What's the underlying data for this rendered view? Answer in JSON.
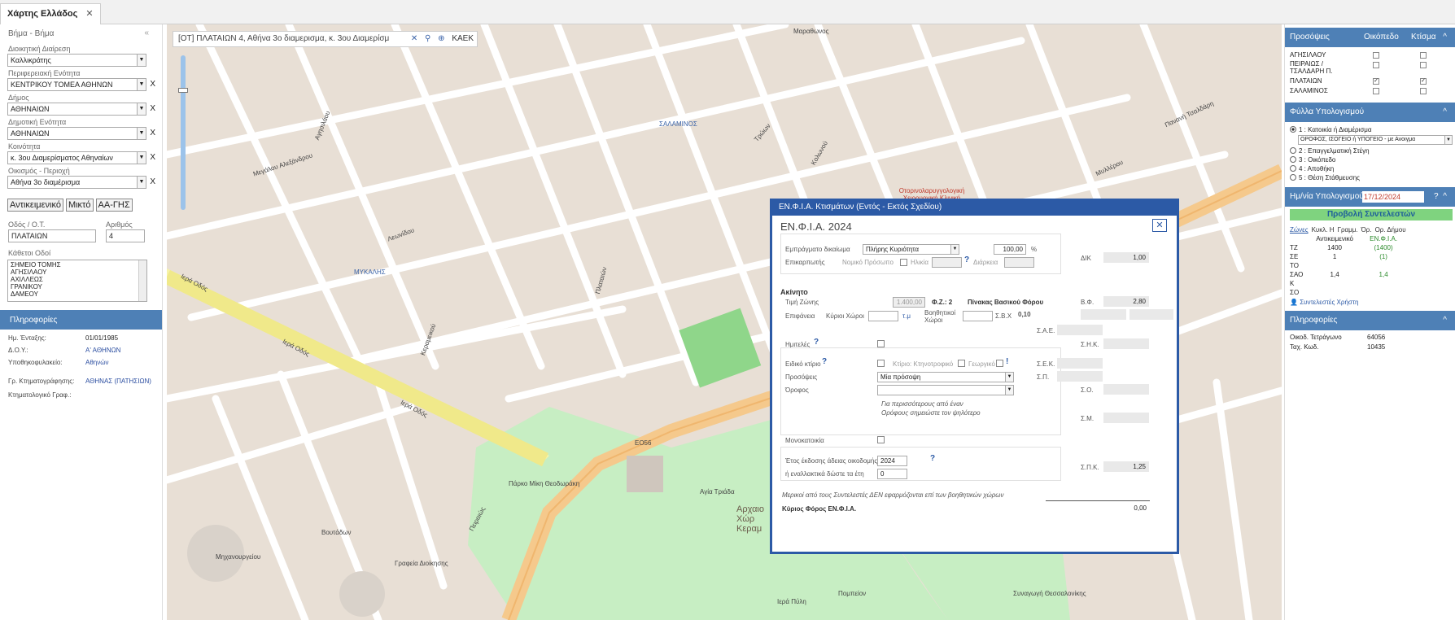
{
  "tab": {
    "title": "Χάρτης Ελλάδος",
    "close": "✕"
  },
  "left": {
    "step": "Βήμα - Βήμα",
    "fields": [
      {
        "label": "Διοικητική Διαίρεση",
        "value": "Καλλικράτης",
        "clear": ""
      },
      {
        "label": "Περιφερειακή Ενότητα",
        "value": "ΚΕΝΤΡΙΚΟΥ ΤΟΜΕΑ ΑΘΗΝΩΝ",
        "clear": "X"
      },
      {
        "label": "Δήμος",
        "value": "ΑΘΗΝΑΙΩΝ",
        "clear": "X"
      },
      {
        "label": "Δημοτική Ενότητα",
        "value": "ΑΘΗΝΑΙΩΝ",
        "clear": "X"
      },
      {
        "label": "Κοινότητα",
        "value": "κ. 3ου Διαμερίσματος Αθηναίων",
        "clear": "X"
      },
      {
        "label": "Οικισμός - Περιοχή",
        "value": "Αθήνα 3ο διαμέρισμα",
        "clear": "X"
      }
    ],
    "buttons": [
      "Αντικειμενικό",
      "Μικτό",
      "ΑΑ-ΓΗΣ"
    ],
    "street_label": "Οδός / Ο.Τ.",
    "number_label": "Αριθμός",
    "street_value": "ΠΛΑΤΑΙΩΝ",
    "number_value": "4",
    "cross_label": "Κάθετοι Οδοί",
    "cross_streets": [
      "ΣΗΜΕΙΟ ΤΟΜΗΣ",
      "ΑΓΗΣΙΛΑΟΥ",
      "ΑΧΙΛΛΕΩΣ",
      "ΓΡΑΝΙΚΟΥ",
      "ΔΑΜΕΟΥ"
    ],
    "info_title": "Πληροφορίες",
    "info": [
      {
        "k": "Ημ. Ένταξης:",
        "v": "01/01/1985"
      },
      {
        "k": "Δ.Ο.Υ.:",
        "v": "Α' ΑΘΗΝΩΝ"
      },
      {
        "k": "Υποθηκοφυλακείο:",
        "v": "Αθηνών"
      },
      {
        "k": "Γρ. Κτηματογράφησης:",
        "v": "ΑΘΗΝΑΣ (ΠΑΤΗΣΙΩΝ)"
      },
      {
        "k": "Κτηματολογικό Γραφ.:",
        "v": ""
      }
    ]
  },
  "map": {
    "search_text": "[ΟΤ] ΠΛΑΤΑΙΩΝ 4, Αθήνα 3ο διαμερισμα, κ. 3ου Διαμερίσμ",
    "search_icons": [
      "✕",
      "⚲",
      "⊕"
    ],
    "kaek": "ΚΑΕΚ",
    "labels": [
      {
        "t": "Ιερά Οδός"
      },
      {
        "t": "Ιερά Οδός"
      },
      {
        "t": "Ιερά Οδός"
      },
      {
        "t": "Πειραιώς"
      },
      {
        "t": "Πλαταιών"
      },
      {
        "t": "Κεραμεικού"
      },
      {
        "t": "Μεγάλου Αλεξάνδρου"
      },
      {
        "t": "Λεωνίδου"
      },
      {
        "t": "Αγησιλάου"
      },
      {
        "t": "Κολωνού"
      },
      {
        "t": "Μυλλέρου"
      },
      {
        "t": "Πανανή Τσαλδάρη"
      },
      {
        "t": "Μαραθωνος"
      },
      {
        "t": "Τρώων"
      },
      {
        "t": "Μηχανουργείου"
      },
      {
        "t": "Βουτάδων"
      },
      {
        "t": "Πάρκο Μίκη Θεοδωράκη"
      },
      {
        "t": "Αγία Τριάδα"
      },
      {
        "t": "Γραφεία Διοίκησης"
      },
      {
        "t": "ΕΟ56"
      },
      {
        "t": "ΜΥΚΑΛΗΣ"
      },
      {
        "t": "ΣΑΛΑΜΙΝΟΣ"
      },
      {
        "t": "Οτορινολαρυγγολογική Χειρουργική Κλινική"
      },
      {
        "t": "Αρχαιο Χώρ Κεραμ"
      },
      {
        "t": "Πομπείον"
      },
      {
        "t": "Ιερά Πύλη"
      },
      {
        "t": "Συναγωγή Θεσσαλονίκης"
      }
    ]
  },
  "dialog": {
    "title": "ΕΝ.Φ.Ι.Α. Κτισμάτων (Εντός - Εκτός Σχεδίου)",
    "heading": "ΕΝ.Φ.Ι.Α. 2024",
    "close": "✕",
    "rights_label": "Εμπράγματο δικαίωμα",
    "rights_value": "Πλήρης Κυριότητα",
    "percent_value": "100,00",
    "percent_unit": "%",
    "usufruct_label": "Επικαρπωτής",
    "legal_label": "Νομικό Πρόσωπο",
    "age_label": "Ηλικία",
    "duration_label": "Διάρκεια",
    "dik_label": "ΔΙΚ",
    "dik_value": "1,00",
    "property_label": "Ακίνητο",
    "zone_price_label": "Τιμή Ζώνης",
    "zone_price_value": "1.400,00",
    "fz_label": "Φ.Ζ.: 2",
    "table_label": "Πίνακας Βασικού Φόρου",
    "bf_label": "Β.Φ.",
    "bf_value": "2,80",
    "area_label": "Επιφάνεια",
    "main_area_label": "Κύριοι Χώροι",
    "area_unit": "τ.μ",
    "aux_label": "Βοηθητικοί Χώροι",
    "sbx_label": "Σ.Β.Χ",
    "sbx_value": "0,10",
    "sae_label": "Σ.Α.Ε.",
    "half_label": "Ημιτελές",
    "snk_label": "Σ.Η.Κ.",
    "special_label": "Ειδικό κτίριο",
    "special_opts": "Κτίριο: Κτηνοτροφικό",
    "special_opts2": "Γεωργικό",
    "sek_label": "Σ.Ε.Κ.",
    "sp_label": "Σ.Π.",
    "facades_label": "Προσόψεις",
    "facades_value": "Μία πρόσοψη",
    "floor_label": "Όροφος",
    "floor_value": "",
    "so_label": "Σ.Ο.",
    "note1": "Για περισσότερους από έναν",
    "note2": "Ορόφους σημειώστε τον ψηλότερο",
    "sm_label": "Σ.Μ.",
    "single_label": "Μονοκατοικία",
    "year_label": "Έτος έκδοσης άδειας οικοδομής",
    "year_value": "2024",
    "alt_label": "ή εναλλακτικά δώστε τα έτη",
    "alt_value": "0",
    "spk_label": "Σ.Π.Κ.",
    "spk_value": "1,25",
    "footnote": "Μερικοί από τους Συντελεστές ΔΕΝ εφαρμόζονται επί των βοηθητικών χώρων",
    "tax_label": "Κύριος Φόρος ΕΝ.Φ.Ι.Α.",
    "tax_value": "0,00",
    "q": "?"
  },
  "right": {
    "facades_title": "Προσόψεις",
    "col_plot": "Οικόπεδο",
    "col_building": "Κτίσμα",
    "facades": [
      {
        "name": "ΑΓΗΣΙΛΑΟΥ",
        "plot": "",
        "building": ""
      },
      {
        "name": "ΠΕΙΡΑΙΩΣ / ΤΣΑΛΔΑΡΗ Π.",
        "plot": "",
        "building": ""
      },
      {
        "name": "ΠΛΑΤΑΙΩΝ",
        "plot": "✓",
        "building": "✓"
      },
      {
        "name": "ΣΑΛΑΜΙΝΟΣ",
        "plot": "",
        "building": ""
      }
    ],
    "sheet_title": "Φύλλα Υπολογισμού",
    "sheets": [
      {
        "label": "1 : Κατοικία ή Διαμέρισμα",
        "on": true
      },
      {
        "label": "2 : Επαγγελματική Στέγη",
        "on": false
      },
      {
        "label": "3 : Οικόπεδο",
        "on": false
      },
      {
        "label": "4 : Αποθήκη",
        "on": false
      },
      {
        "label": "5 : Θέση Στάθμευσης",
        "on": false
      }
    ],
    "floor_select": "ΟΡΟΦΟΣ, ΙΣΟΓΕΙΟ ή ΥΠΟΓΕΙΟ - με Ανοιγμα",
    "date_label": "Ημ/νία Υπολογισμού",
    "date_value": "17/12/2024",
    "q": "?",
    "show_btn": "Προβολή Συντελεστών",
    "coef_headers": [
      "Ζώνες",
      "Κυκλ. Η",
      "Γραμμ.",
      "Όρ.",
      "Ορ. Δήμου"
    ],
    "coef_sub_obj": "Αντικειμενικό",
    "coef_sub_enfia": "ΕΝ.Φ.Ι.Α.",
    "coef_rows": [
      {
        "k": "ΤΖ",
        "a": "1400",
        "b": "(1400)"
      },
      {
        "k": "ΣΕ",
        "a": "1",
        "b": "(1)"
      },
      {
        "k": "ΤΟ",
        "a": "",
        "b": ""
      },
      {
        "k": "ΣΑΟ",
        "a": "1,4",
        "b": "1,4"
      },
      {
        "k": "Κ",
        "a": "",
        "b": ""
      },
      {
        "k": "ΣΟ",
        "a": "",
        "b": ""
      }
    ],
    "user_coef": "Συντελεστές Χρήστη",
    "info_title": "Πληροφορίες",
    "info": [
      {
        "k": "Οικοδ. Τετράγωνο",
        "v": "64056"
      },
      {
        "k": "Ταχ. Κωδ.",
        "v": "10435"
      }
    ]
  }
}
